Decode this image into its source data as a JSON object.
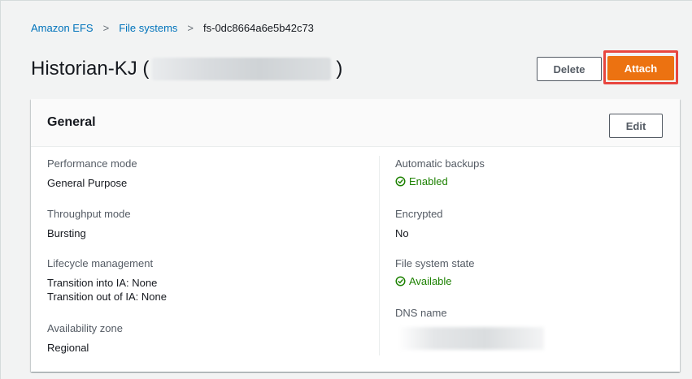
{
  "breadcrumb": {
    "items": [
      "Amazon EFS",
      "File systems",
      "fs-0dc8664a6e5b42c73"
    ],
    "separator": ">"
  },
  "header": {
    "title_prefix": "Historian-KJ (",
    "title_suffix": ")",
    "delete_label": "Delete",
    "attach_label": "Attach"
  },
  "general": {
    "title": "General",
    "edit_label": "Edit",
    "left": [
      {
        "label": "Performance mode",
        "value": "General Purpose"
      },
      {
        "label": "Throughput mode",
        "value": "Bursting"
      },
      {
        "label": "Lifecycle management",
        "value": "Transition into IA: None",
        "value2": "Transition out of IA: None"
      },
      {
        "label": "Availability zone",
        "value": "Regional"
      }
    ],
    "right": [
      {
        "label": "Automatic backups",
        "value": "Enabled"
      },
      {
        "label": "Encrypted",
        "value": "No"
      },
      {
        "label": "File system state",
        "value": "Available"
      },
      {
        "label": "DNS name"
      }
    ]
  },
  "colors": {
    "link": "#0073bb",
    "primary": "#ec7211",
    "success": "#1d8102",
    "highlight": "#e8463f"
  },
  "icons": {
    "status": "check-circle-icon"
  }
}
